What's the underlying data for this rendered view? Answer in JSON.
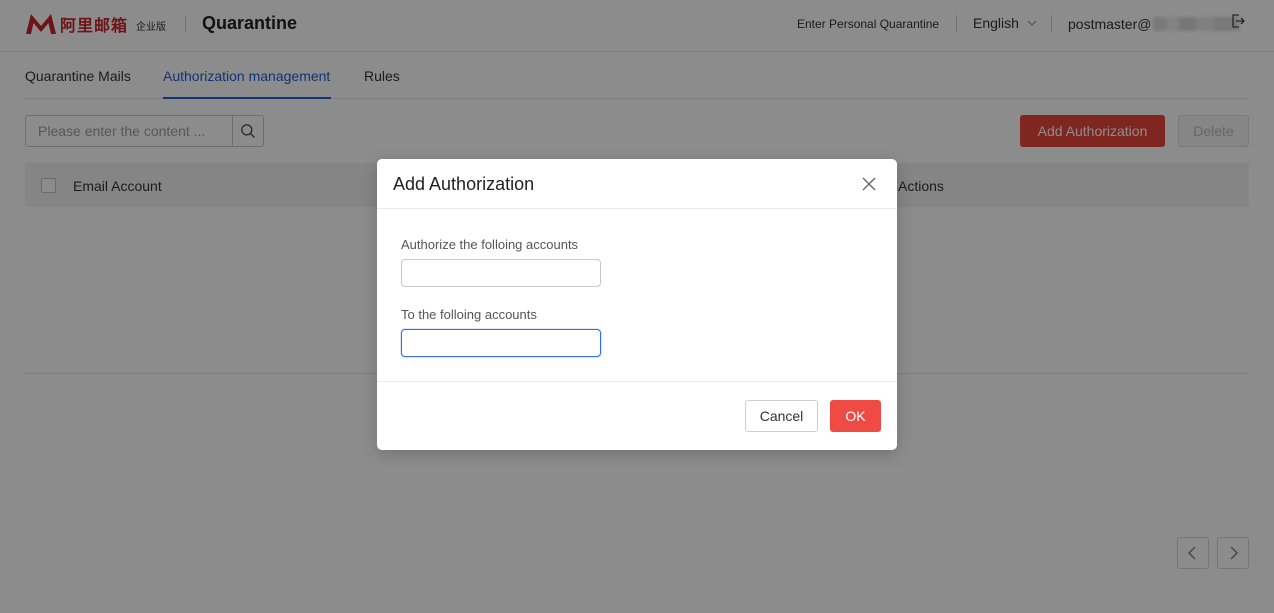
{
  "header": {
    "logo_cn": "阿里邮箱",
    "logo_edition": "企业版",
    "app_title": "Quarantine",
    "personal_quarantine": "Enter Personal Quarantine",
    "language": "English",
    "user": "postmaster@"
  },
  "tabs": [
    {
      "label": "Quarantine Mails"
    },
    {
      "label": "Authorization management",
      "active": true
    },
    {
      "label": "Rules"
    }
  ],
  "toolbar": {
    "search_placeholder": "Please enter the content ...",
    "add_label": "Add Authorization",
    "delete_label": "Delete"
  },
  "table": {
    "col_account": "Email Account",
    "col_actions": "Actions"
  },
  "modal": {
    "title": "Add Authorization",
    "field1_label": "Authorize the folloing accounts",
    "field1_value": "",
    "field2_label": "To the folloing accounts",
    "field2_value": "",
    "cancel_label": "Cancel",
    "ok_label": "OK"
  },
  "colors": {
    "brand_red": "#c8252c",
    "primary_button": "#e8453c",
    "ok_button": "#f04a45",
    "active_tab": "#1d5fd6",
    "focus_border": "#2e6ee6"
  },
  "icons": [
    "ali-mail-logo-icon",
    "chevron-down-icon",
    "logout-icon",
    "search-icon",
    "close-icon",
    "chevron-left-icon",
    "chevron-right-icon"
  ]
}
